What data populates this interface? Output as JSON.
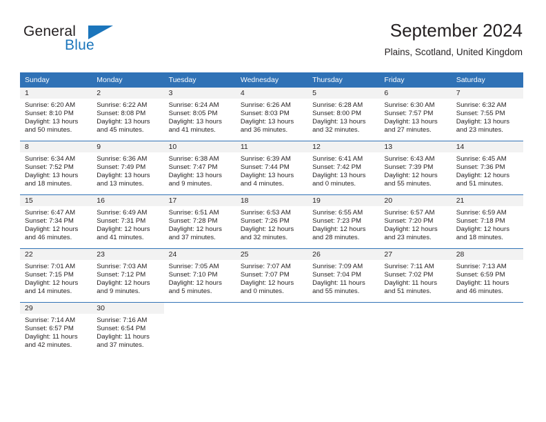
{
  "brand": {
    "name_part1": "General",
    "name_part2": "Blue",
    "flag_icon": "triangle-flag-icon"
  },
  "header": {
    "title": "September 2024",
    "subtitle": "Plains, Scotland, United Kingdom"
  },
  "colors": {
    "header_row": "#3072b6",
    "brand_blue": "#1b75bb",
    "day_band": "#f2f2f2",
    "text": "#231f20"
  },
  "calendar": {
    "weekday_headers": [
      "Sunday",
      "Monday",
      "Tuesday",
      "Wednesday",
      "Thursday",
      "Friday",
      "Saturday"
    ],
    "weeks": [
      [
        {
          "day": "1",
          "sunrise": "Sunrise: 6:20 AM",
          "sunset": "Sunset: 8:10 PM",
          "daylight1": "Daylight: 13 hours",
          "daylight2": "and 50 minutes."
        },
        {
          "day": "2",
          "sunrise": "Sunrise: 6:22 AM",
          "sunset": "Sunset: 8:08 PM",
          "daylight1": "Daylight: 13 hours",
          "daylight2": "and 45 minutes."
        },
        {
          "day": "3",
          "sunrise": "Sunrise: 6:24 AM",
          "sunset": "Sunset: 8:05 PM",
          "daylight1": "Daylight: 13 hours",
          "daylight2": "and 41 minutes."
        },
        {
          "day": "4",
          "sunrise": "Sunrise: 6:26 AM",
          "sunset": "Sunset: 8:03 PM",
          "daylight1": "Daylight: 13 hours",
          "daylight2": "and 36 minutes."
        },
        {
          "day": "5",
          "sunrise": "Sunrise: 6:28 AM",
          "sunset": "Sunset: 8:00 PM",
          "daylight1": "Daylight: 13 hours",
          "daylight2": "and 32 minutes."
        },
        {
          "day": "6",
          "sunrise": "Sunrise: 6:30 AM",
          "sunset": "Sunset: 7:57 PM",
          "daylight1": "Daylight: 13 hours",
          "daylight2": "and 27 minutes."
        },
        {
          "day": "7",
          "sunrise": "Sunrise: 6:32 AM",
          "sunset": "Sunset: 7:55 PM",
          "daylight1": "Daylight: 13 hours",
          "daylight2": "and 23 minutes."
        }
      ],
      [
        {
          "day": "8",
          "sunrise": "Sunrise: 6:34 AM",
          "sunset": "Sunset: 7:52 PM",
          "daylight1": "Daylight: 13 hours",
          "daylight2": "and 18 minutes."
        },
        {
          "day": "9",
          "sunrise": "Sunrise: 6:36 AM",
          "sunset": "Sunset: 7:49 PM",
          "daylight1": "Daylight: 13 hours",
          "daylight2": "and 13 minutes."
        },
        {
          "day": "10",
          "sunrise": "Sunrise: 6:38 AM",
          "sunset": "Sunset: 7:47 PM",
          "daylight1": "Daylight: 13 hours",
          "daylight2": "and 9 minutes."
        },
        {
          "day": "11",
          "sunrise": "Sunrise: 6:39 AM",
          "sunset": "Sunset: 7:44 PM",
          "daylight1": "Daylight: 13 hours",
          "daylight2": "and 4 minutes."
        },
        {
          "day": "12",
          "sunrise": "Sunrise: 6:41 AM",
          "sunset": "Sunset: 7:42 PM",
          "daylight1": "Daylight: 13 hours",
          "daylight2": "and 0 minutes."
        },
        {
          "day": "13",
          "sunrise": "Sunrise: 6:43 AM",
          "sunset": "Sunset: 7:39 PM",
          "daylight1": "Daylight: 12 hours",
          "daylight2": "and 55 minutes."
        },
        {
          "day": "14",
          "sunrise": "Sunrise: 6:45 AM",
          "sunset": "Sunset: 7:36 PM",
          "daylight1": "Daylight: 12 hours",
          "daylight2": "and 51 minutes."
        }
      ],
      [
        {
          "day": "15",
          "sunrise": "Sunrise: 6:47 AM",
          "sunset": "Sunset: 7:34 PM",
          "daylight1": "Daylight: 12 hours",
          "daylight2": "and 46 minutes."
        },
        {
          "day": "16",
          "sunrise": "Sunrise: 6:49 AM",
          "sunset": "Sunset: 7:31 PM",
          "daylight1": "Daylight: 12 hours",
          "daylight2": "and 41 minutes."
        },
        {
          "day": "17",
          "sunrise": "Sunrise: 6:51 AM",
          "sunset": "Sunset: 7:28 PM",
          "daylight1": "Daylight: 12 hours",
          "daylight2": "and 37 minutes."
        },
        {
          "day": "18",
          "sunrise": "Sunrise: 6:53 AM",
          "sunset": "Sunset: 7:26 PM",
          "daylight1": "Daylight: 12 hours",
          "daylight2": "and 32 minutes."
        },
        {
          "day": "19",
          "sunrise": "Sunrise: 6:55 AM",
          "sunset": "Sunset: 7:23 PM",
          "daylight1": "Daylight: 12 hours",
          "daylight2": "and 28 minutes."
        },
        {
          "day": "20",
          "sunrise": "Sunrise: 6:57 AM",
          "sunset": "Sunset: 7:20 PM",
          "daylight1": "Daylight: 12 hours",
          "daylight2": "and 23 minutes."
        },
        {
          "day": "21",
          "sunrise": "Sunrise: 6:59 AM",
          "sunset": "Sunset: 7:18 PM",
          "daylight1": "Daylight: 12 hours",
          "daylight2": "and 18 minutes."
        }
      ],
      [
        {
          "day": "22",
          "sunrise": "Sunrise: 7:01 AM",
          "sunset": "Sunset: 7:15 PM",
          "daylight1": "Daylight: 12 hours",
          "daylight2": "and 14 minutes."
        },
        {
          "day": "23",
          "sunrise": "Sunrise: 7:03 AM",
          "sunset": "Sunset: 7:12 PM",
          "daylight1": "Daylight: 12 hours",
          "daylight2": "and 9 minutes."
        },
        {
          "day": "24",
          "sunrise": "Sunrise: 7:05 AM",
          "sunset": "Sunset: 7:10 PM",
          "daylight1": "Daylight: 12 hours",
          "daylight2": "and 5 minutes."
        },
        {
          "day": "25",
          "sunrise": "Sunrise: 7:07 AM",
          "sunset": "Sunset: 7:07 PM",
          "daylight1": "Daylight: 12 hours",
          "daylight2": "and 0 minutes."
        },
        {
          "day": "26",
          "sunrise": "Sunrise: 7:09 AM",
          "sunset": "Sunset: 7:04 PM",
          "daylight1": "Daylight: 11 hours",
          "daylight2": "and 55 minutes."
        },
        {
          "day": "27",
          "sunrise": "Sunrise: 7:11 AM",
          "sunset": "Sunset: 7:02 PM",
          "daylight1": "Daylight: 11 hours",
          "daylight2": "and 51 minutes."
        },
        {
          "day": "28",
          "sunrise": "Sunrise: 7:13 AM",
          "sunset": "Sunset: 6:59 PM",
          "daylight1": "Daylight: 11 hours",
          "daylight2": "and 46 minutes."
        }
      ],
      [
        {
          "day": "29",
          "sunrise": "Sunrise: 7:14 AM",
          "sunset": "Sunset: 6:57 PM",
          "daylight1": "Daylight: 11 hours",
          "daylight2": "and 42 minutes."
        },
        {
          "day": "30",
          "sunrise": "Sunrise: 7:16 AM",
          "sunset": "Sunset: 6:54 PM",
          "daylight1": "Daylight: 11 hours",
          "daylight2": "and 37 minutes."
        },
        {
          "day": "",
          "sunrise": "",
          "sunset": "",
          "daylight1": "",
          "daylight2": ""
        },
        {
          "day": "",
          "sunrise": "",
          "sunset": "",
          "daylight1": "",
          "daylight2": ""
        },
        {
          "day": "",
          "sunrise": "",
          "sunset": "",
          "daylight1": "",
          "daylight2": ""
        },
        {
          "day": "",
          "sunrise": "",
          "sunset": "",
          "daylight1": "",
          "daylight2": ""
        },
        {
          "day": "",
          "sunrise": "",
          "sunset": "",
          "daylight1": "",
          "daylight2": ""
        }
      ]
    ]
  }
}
